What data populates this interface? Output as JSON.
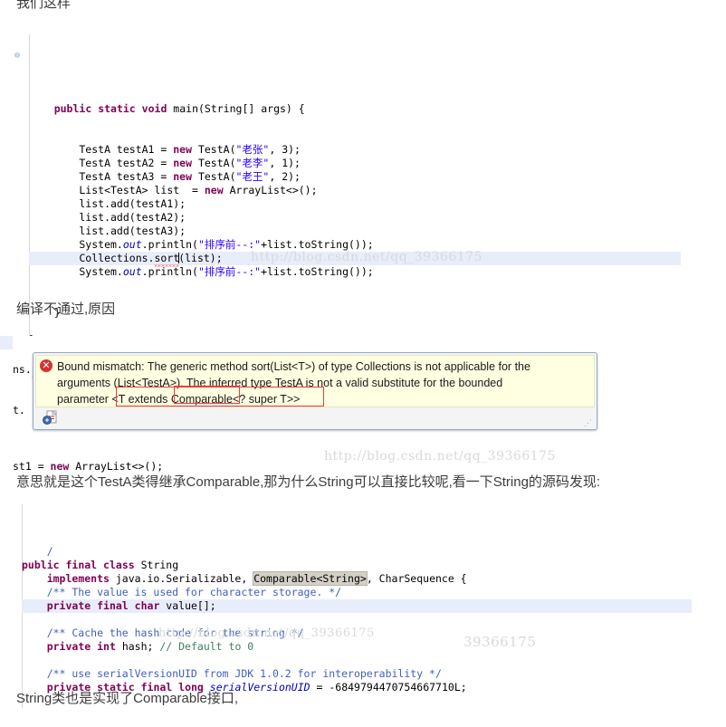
{
  "page": {
    "background": "#ffffff",
    "accent_error": "#d83131",
    "annotation_red": "#ef3b3b",
    "highlight_blue": "#e8edfb",
    "watermark_color": "#d9d9d9"
  },
  "paragraphs": {
    "intro": "我们这样",
    "compile_fail": "编译不通过,原因",
    "explanation": "意思就是这个TestA类得继承Comparable,那为什么String可以直接比较呢,看一下String的源码发现:",
    "conclusion": "String类也是实现了Comparable接口,"
  },
  "watermarks": {
    "code_block_one": "http://blog.csdn.net/qq_39366175",
    "dialog_area": "http://blog.csdn.net/qq_39366175",
    "string_source": "39366175",
    "string_source_mid": "http://blog.csdn.net/qq_39366175"
  },
  "code_main": {
    "fold_marker": "⊖",
    "lines": [
      {
        "id": "blank-top",
        "tokens": []
      },
      {
        "id": "main-signature",
        "tokens": [
          {
            "t": "    ",
            "c": "plain"
          },
          {
            "t": "public",
            "c": "kw"
          },
          {
            "t": " ",
            "c": "plain"
          },
          {
            "t": "static",
            "c": "kw"
          },
          {
            "t": " ",
            "c": "plain"
          },
          {
            "t": "void",
            "c": "kw"
          },
          {
            "t": " main(String[] args) {",
            "c": "plain"
          }
        ]
      },
      {
        "id": "blank-1",
        "tokens": []
      },
      {
        "id": "blank-2",
        "tokens": []
      },
      {
        "id": "decl-testA1",
        "tokens": [
          {
            "t": "        TestA testA1 = ",
            "c": "plain"
          },
          {
            "t": "new",
            "c": "kw"
          },
          {
            "t": " TestA(",
            "c": "plain"
          },
          {
            "t": "\"老张\"",
            "c": "str"
          },
          {
            "t": ", 3);",
            "c": "plain"
          }
        ]
      },
      {
        "id": "decl-testA2",
        "tokens": [
          {
            "t": "        TestA testA2 = ",
            "c": "plain"
          },
          {
            "t": "new",
            "c": "kw"
          },
          {
            "t": " TestA(",
            "c": "plain"
          },
          {
            "t": "\"老李\"",
            "c": "str"
          },
          {
            "t": ", 1);",
            "c": "plain"
          }
        ]
      },
      {
        "id": "decl-testA3",
        "tokens": [
          {
            "t": "        TestA testA3 = ",
            "c": "plain"
          },
          {
            "t": "new",
            "c": "kw"
          },
          {
            "t": " TestA(",
            "c": "plain"
          },
          {
            "t": "\"老王\"",
            "c": "str"
          },
          {
            "t": ", 2);",
            "c": "plain"
          }
        ]
      },
      {
        "id": "decl-list",
        "tokens": [
          {
            "t": "        List<TestA> list  = ",
            "c": "plain"
          },
          {
            "t": "new",
            "c": "kw"
          },
          {
            "t": " ArrayList<>();",
            "c": "plain"
          }
        ]
      },
      {
        "id": "add-1",
        "tokens": [
          {
            "t": "        list.add(testA1);",
            "c": "plain"
          }
        ]
      },
      {
        "id": "add-2",
        "tokens": [
          {
            "t": "        list.add(testA2);",
            "c": "plain"
          }
        ]
      },
      {
        "id": "add-3",
        "tokens": [
          {
            "t": "        list.add(testA3);",
            "c": "plain"
          }
        ]
      },
      {
        "id": "print-before",
        "tokens": [
          {
            "t": "        System.",
            "c": "plain"
          },
          {
            "t": "out",
            "c": "fld"
          },
          {
            "t": ".println(",
            "c": "plain"
          },
          {
            "t": "\"排序前--:\"",
            "c": "str"
          },
          {
            "t": "+list.toString());",
            "c": "plain"
          }
        ]
      },
      {
        "id": "collections-sort",
        "highlight": true,
        "tokens": [
          {
            "t": "        Collections.",
            "c": "plain"
          },
          {
            "t": "sort",
            "c": "plain",
            "squiggle": true,
            "caret": true
          },
          {
            "t": "(list);",
            "c": "plain"
          }
        ]
      },
      {
        "id": "print-after",
        "tokens": [
          {
            "t": "        System.",
            "c": "plain"
          },
          {
            "t": "out",
            "c": "fld"
          },
          {
            "t": ".println(",
            "c": "plain"
          },
          {
            "t": "\"排序前--:\"",
            "c": "str"
          },
          {
            "t": "+list.toString());",
            "c": "plain"
          }
        ]
      },
      {
        "id": "blank-3",
        "tokens": []
      },
      {
        "id": "blank-4",
        "tokens": []
      },
      {
        "id": "close-method",
        "tokens": [
          {
            "t": "    }",
            "c": "plain"
          }
        ]
      },
      {
        "id": "blank-5",
        "tokens": []
      },
      {
        "id": "close-class",
        "tokens": [
          {
            "t": "}",
            "c": "plain"
          }
        ]
      }
    ]
  },
  "code_error_context": {
    "line_above": [
      {
        "t": "ns.",
        "c": "plain"
      },
      {
        "t": "sort",
        "c": "plain",
        "squiggle": true
      },
      {
        "t": "(list);",
        "c": "plain"
      }
    ],
    "line_behind": [
      {
        "t": "t.",
        "c": "plain"
      }
    ],
    "line_below": [
      {
        "t": "st1 = ",
        "c": "plain"
      },
      {
        "t": "new",
        "c": "kw"
      },
      {
        "t": " ArrayList<>();",
        "c": "plain"
      }
    ]
  },
  "error_dialog": {
    "icon": "error-circle-icon",
    "icon_glyph": "✕",
    "message_line_1": "Bound mismatch: The generic method sort(List<T>) of type Collections is not applicable for the",
    "message_line_2": "arguments (List<TestA>). The inferred type TestA is not a valid substitute for the bounded",
    "message_line_3_prefix": "parameter ",
    "message_line_3_a": "<T extends ",
    "message_line_3_b": "Comparable",
    "message_line_3_c": "<? super T>>",
    "quickfix_icon": "quickfix-lightbulb-icon",
    "resize_grip": "⋰"
  },
  "code_string_source": {
    "lines": [
      {
        "id": "stray-comment",
        "tokens": [
          {
            "t": "    /",
            "c": "jdoc"
          }
        ]
      },
      {
        "id": "class-decl",
        "tokens": [
          {
            "t": "public",
            "c": "kw"
          },
          {
            "t": " ",
            "c": "plain"
          },
          {
            "t": "final",
            "c": "kw"
          },
          {
            "t": " ",
            "c": "plain"
          },
          {
            "t": "class",
            "c": "kw"
          },
          {
            "t": " String",
            "c": "plain"
          }
        ]
      },
      {
        "id": "implements-clause",
        "tokens": [
          {
            "t": "    ",
            "c": "plain"
          },
          {
            "t": "implements",
            "c": "kw"
          },
          {
            "t": " java.io.Serializable, ",
            "c": "plain"
          },
          {
            "t": "Comparable<String>",
            "c": "plain",
            "box": true
          },
          {
            "t": ", CharSequence {",
            "c": "plain"
          }
        ]
      },
      {
        "id": "javadoc-value",
        "tokens": [
          {
            "t": "    /** The value is used for character storage. */",
            "c": "jdoc"
          }
        ]
      },
      {
        "id": "field-value",
        "highlight": true,
        "tokens": [
          {
            "t": "    ",
            "c": "plain"
          },
          {
            "t": "private",
            "c": "kw"
          },
          {
            "t": " ",
            "c": "plain"
          },
          {
            "t": "final",
            "c": "kw"
          },
          {
            "t": " ",
            "c": "plain"
          },
          {
            "t": "char",
            "c": "kw"
          },
          {
            "t": " value[];",
            "c": "plain"
          }
        ]
      },
      {
        "id": "blank-a",
        "tokens": []
      },
      {
        "id": "javadoc-hash",
        "tokens": [
          {
            "t": "    /** Cache the hash code for the string */",
            "c": "jdoc"
          }
        ]
      },
      {
        "id": "field-hash",
        "tokens": [
          {
            "t": "    ",
            "c": "plain"
          },
          {
            "t": "private",
            "c": "kw"
          },
          {
            "t": " ",
            "c": "plain"
          },
          {
            "t": "int",
            "c": "kw"
          },
          {
            "t": " hash; ",
            "c": "plain"
          },
          {
            "t": "// Default to 0",
            "c": "cmt"
          }
        ]
      },
      {
        "id": "blank-b",
        "tokens": []
      },
      {
        "id": "javadoc-uid",
        "tokens": [
          {
            "t": "    /** use serialVersionUID from JDK 1.0.2 for interoperability */",
            "c": "jdoc"
          }
        ]
      },
      {
        "id": "field-uid",
        "tokens": [
          {
            "t": "    ",
            "c": "plain"
          },
          {
            "t": "private",
            "c": "kw"
          },
          {
            "t": " ",
            "c": "plain"
          },
          {
            "t": "static",
            "c": "kw"
          },
          {
            "t": " ",
            "c": "plain"
          },
          {
            "t": "final",
            "c": "kw"
          },
          {
            "t": " ",
            "c": "plain"
          },
          {
            "t": "long",
            "c": "kw"
          },
          {
            "t": " ",
            "c": "plain"
          },
          {
            "t": "serialVersionUID",
            "c": "fld"
          },
          {
            "t": " = -6849794470754667710L;",
            "c": "plain"
          }
        ]
      }
    ]
  }
}
